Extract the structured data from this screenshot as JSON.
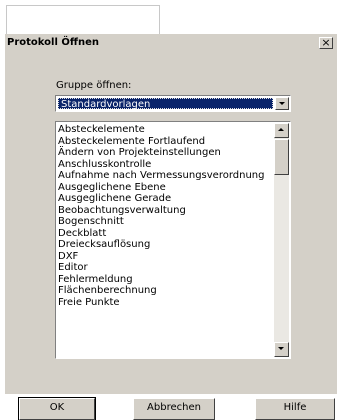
{
  "window": {
    "title": "Protokoll Öffnen",
    "close_glyph": "×"
  },
  "group": {
    "label": "Gruppe öffnen:",
    "selected": "Standardvorlagen"
  },
  "list": {
    "items": [
      "Absteckelemente",
      "Absteckelemente Fortlaufend",
      "Ändern von Projekteinstellungen",
      "Anschlusskontrolle",
      "Aufnahme nach Vermessungsverordnung",
      "Ausgeglichene Ebene",
      "Ausgeglichene Gerade",
      "Beobachtungsverwaltung",
      "Bogenschnitt",
      "Deckblatt",
      "Dreiecksauflösung",
      "DXF",
      "Editor",
      "Fehlermeldung",
      "Flächenberechnung",
      "Freie Punkte"
    ]
  },
  "buttons": {
    "ok": "OK",
    "cancel": "Abbrechen",
    "help": "Hilfe"
  }
}
